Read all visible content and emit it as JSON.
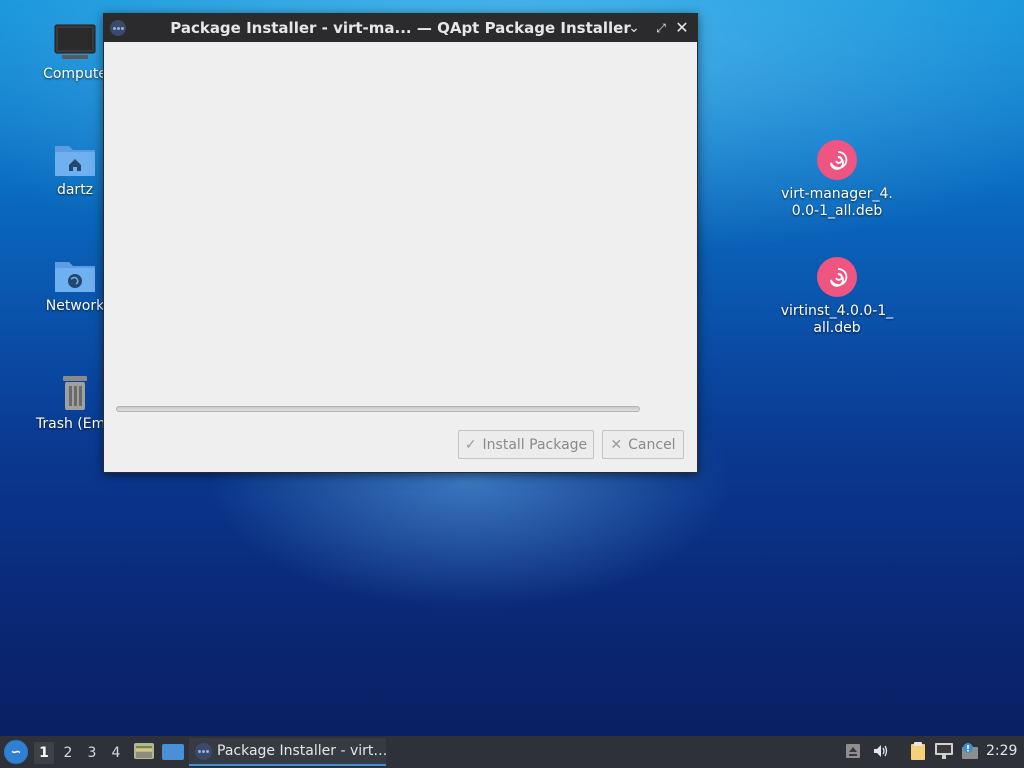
{
  "window": {
    "title": "Package Installer - virt-ma... — QApt Package Installer",
    "progress_fraction": 0.0,
    "install_label": "Install Package",
    "cancel_label": "Cancel",
    "install_icon": "checkmark-icon",
    "cancel_icon": "x-icon"
  },
  "desktop": {
    "icons": [
      {
        "label": "Compute"
      },
      {
        "label": "dartz"
      },
      {
        "label": "Network"
      },
      {
        "label": "Trash (Emp"
      }
    ],
    "files": [
      {
        "label": "virt-manager_4.0.0-1_all.deb",
        "icon": "debian-package-icon"
      },
      {
        "label": "virtinst_4.0.0-1_all.deb",
        "icon": "debian-package-icon"
      }
    ]
  },
  "taskbar": {
    "workspaces": [
      "1",
      "2",
      "3",
      "4"
    ],
    "active_workspace": "1",
    "task_label": "Package Installer - virt…",
    "clock": "2:29"
  },
  "colors": {
    "accent": "#3d8fd6",
    "debian": "#ef5581",
    "titlebar": "#2b2b2e",
    "taskbar": "#2e3238"
  }
}
